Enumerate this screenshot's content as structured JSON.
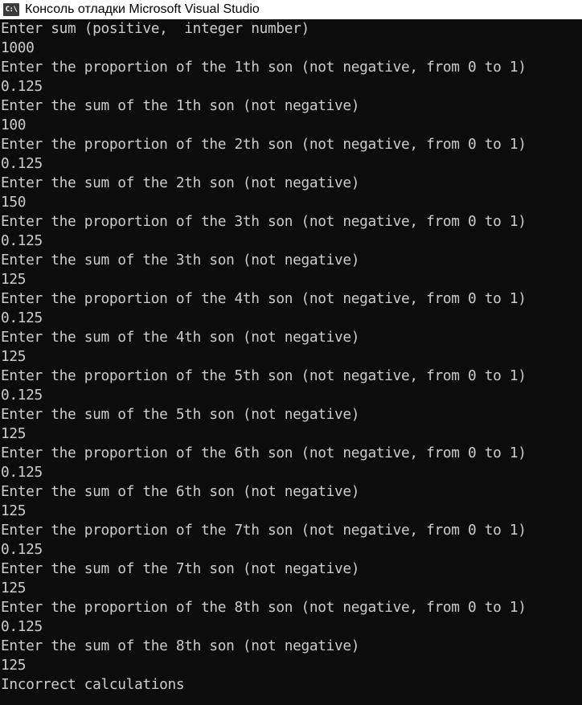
{
  "window": {
    "title": "Консоль отладки Microsoft Visual Studio",
    "icon_name": "console-app-icon",
    "icon_text": "C:\\"
  },
  "colors": {
    "console_bg": "#0c0c0c",
    "console_text": "#cccccc",
    "titlebar_bg": "#ffffff"
  },
  "console": {
    "lines": [
      "Enter sum (positive,  integer number)",
      "1000",
      "Enter the proportion of the 1th son (not negative, from 0 to 1)",
      "0.125",
      "Enter the sum of the 1th son (not negative)",
      "100",
      "Enter the proportion of the 2th son (not negative, from 0 to 1)",
      "0.125",
      "Enter the sum of the 2th son (not negative)",
      "150",
      "Enter the proportion of the 3th son (not negative, from 0 to 1)",
      "0.125",
      "Enter the sum of the 3th son (not negative)",
      "125",
      "Enter the proportion of the 4th son (not negative, from 0 to 1)",
      "0.125",
      "Enter the sum of the 4th son (not negative)",
      "125",
      "Enter the proportion of the 5th son (not negative, from 0 to 1)",
      "0.125",
      "Enter the sum of the 5th son (not negative)",
      "125",
      "Enter the proportion of the 6th son (not negative, from 0 to 1)",
      "0.125",
      "Enter the sum of the 6th son (not negative)",
      "125",
      "Enter the proportion of the 7th son (not negative, from 0 to 1)",
      "0.125",
      "Enter the sum of the 7th son (not negative)",
      "125",
      "Enter the proportion of the 8th son (not negative, from 0 to 1)",
      "0.125",
      "Enter the sum of the 8th son (not negative)",
      "125",
      "Incorrect calculations"
    ]
  }
}
